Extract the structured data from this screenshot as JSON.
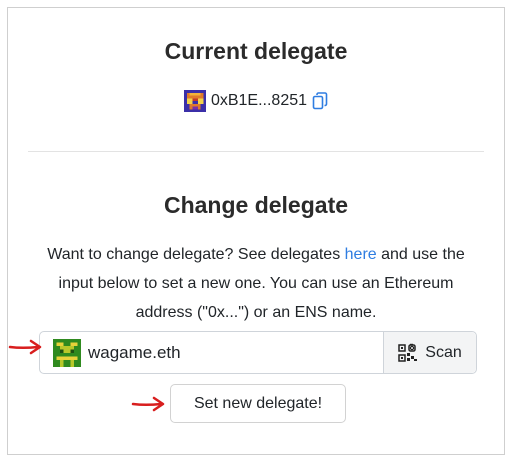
{
  "current_section": {
    "title": "Current delegate",
    "address": "0xB1E...8251",
    "copy_icon": "copy-icon"
  },
  "change_section": {
    "title": "Change delegate",
    "description_before_link": "Want to change delegate? See delegates ",
    "link_text": "here",
    "description_after_link": " and use the input below to set a new one. You can use an Ethereum address (\"0x...\") or an ENS name."
  },
  "delegate_input": {
    "value": "wagame.eth",
    "scan_label": "Scan",
    "scan_icon": "qr-scan-icon"
  },
  "submit_button": {
    "label": "Set new delegate!"
  },
  "colors": {
    "link": "#2f7de1",
    "arrow": "#d81e1e"
  }
}
